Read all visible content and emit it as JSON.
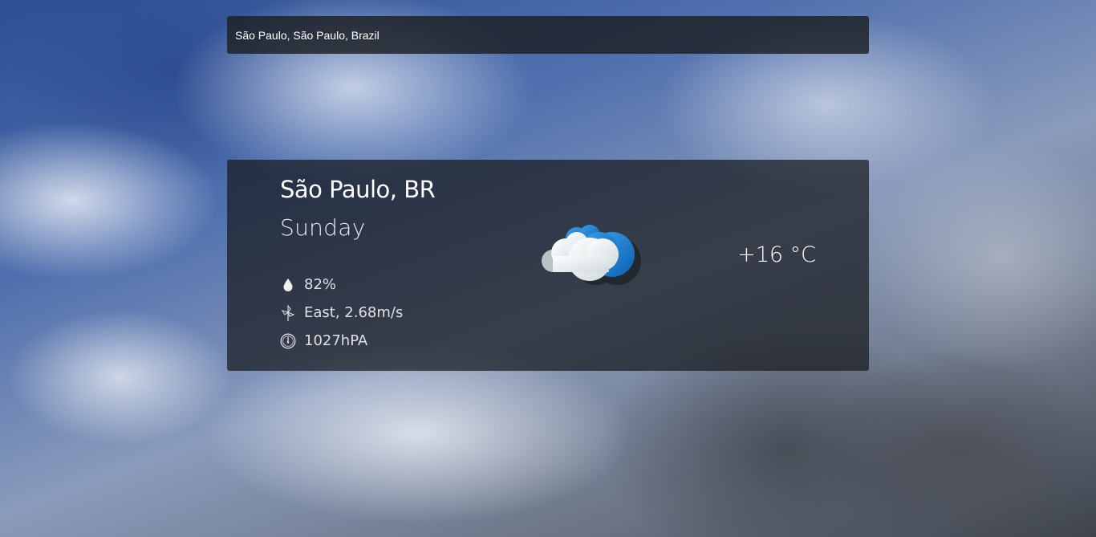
{
  "search": {
    "value": "São Paulo, São Paulo, Brazil"
  },
  "weather": {
    "location": "São Paulo, BR",
    "day": "Sunday",
    "humidity": "82%",
    "wind": "East, 2.68m/s",
    "pressure": "1027hPA",
    "temperature": "+16 °C",
    "condition_icon": "cloudy-icon"
  },
  "icons": {
    "humidity": "droplet-icon",
    "wind": "wind-icon",
    "pressure": "barometer-icon"
  },
  "colors": {
    "panel": "#1c1e22",
    "text": "#ffffff",
    "cloud_blue": "#1e7fd0",
    "cloud_white": "#e8eef0"
  }
}
